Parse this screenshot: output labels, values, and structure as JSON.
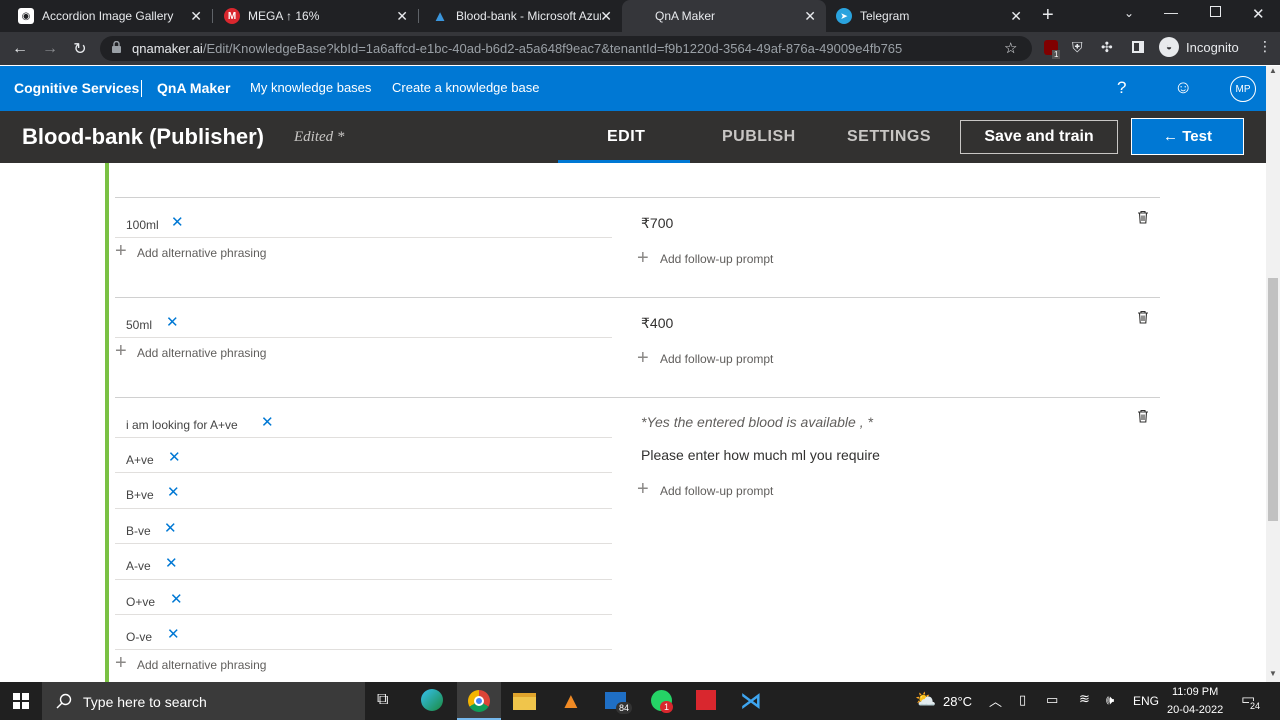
{
  "browser": {
    "tabs": [
      {
        "title": "Accordion Image Gallery",
        "favicon": "gallery-icon"
      },
      {
        "title": "MEGA ↑ 16%",
        "favicon": "mega-icon"
      },
      {
        "title": "Blood-bank - Microsoft Azure",
        "favicon": "azure-icon"
      },
      {
        "title": "QnA Maker",
        "favicon": "microsoft-icon"
      },
      {
        "title": "Telegram",
        "favicon": "telegram-icon"
      }
    ],
    "active_tab": 3,
    "new_tab": "+",
    "url_domain": "qnamaker.ai",
    "url_path": "/Edit/KnowledgeBase?kbId=1a6affcd-e1bc-40ad-b6d2-a5a648f9eac7&tenantId=f9b1220d-3564-49af-876a-49009e4fb765",
    "profile_label": "Incognito",
    "extension_badge": "1"
  },
  "azure_nav": {
    "brand": "Cognitive Services",
    "product": "QnA Maker",
    "links": [
      "My knowledge bases",
      "Create a knowledge base"
    ],
    "help": "?",
    "avatar": "MP"
  },
  "kb_header": {
    "title": "Blood-bank (Publisher)",
    "status": "Edited *",
    "tabs": [
      "EDIT",
      "PUBLISH",
      "SETTINGS"
    ],
    "active_tab": "EDIT",
    "save_label": "Save and train",
    "test_label": "← Test"
  },
  "qna_pairs": [
    {
      "questions": [
        "100ml"
      ],
      "add_alt": "Add alternative phrasing",
      "answer_lines": [
        "₹700"
      ],
      "add_prompt": "Add follow-up prompt"
    },
    {
      "questions": [
        "50ml"
      ],
      "add_alt": "Add alternative phrasing",
      "answer_lines": [
        "₹400"
      ],
      "add_prompt": "Add follow-up prompt"
    },
    {
      "questions": [
        "i am looking for A+ve",
        "A+ve",
        "B+ve",
        "B-ve",
        "A-ve",
        "O+ve",
        "O-ve"
      ],
      "add_alt": "Add alternative phrasing",
      "answer_lines": [
        "*Yes the entered blood is available , *",
        "Please enter how much ml you require"
      ],
      "add_prompt": "Add follow-up prompt"
    }
  ],
  "taskbar": {
    "search_placeholder": "Type here to search",
    "weather": "28°C",
    "language": "ENG",
    "time": "11:09 PM",
    "date": "20-04-2022",
    "notification_count": "24",
    "mail_badge": "84",
    "whatsapp_badge": "1"
  },
  "colors": {
    "azure_blue": "#0078d4",
    "header_dark": "#323130",
    "accent_green": "#7ac143"
  }
}
